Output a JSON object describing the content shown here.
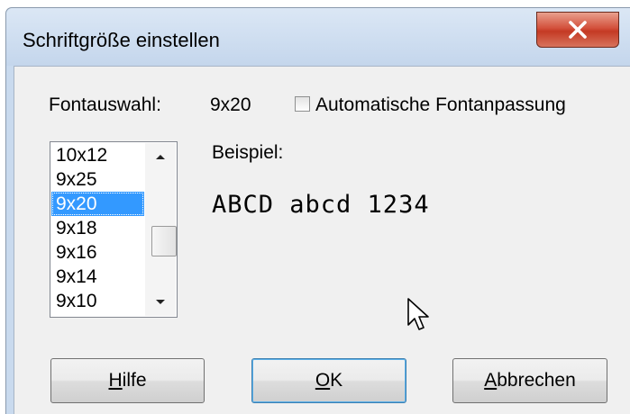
{
  "window": {
    "title": "Schriftgröße einstellen"
  },
  "title_bar": {
    "close_icon": "close-icon"
  },
  "font_selection": {
    "label": "Fontauswahl:",
    "current_value": "9x20",
    "auto_fit_checkbox": {
      "label": "Automatische Fontanpassung",
      "checked": false
    }
  },
  "font_list": {
    "items": [
      "10x12",
      "9x25",
      "9x20",
      "9x18",
      "9x16",
      "9x14",
      "9x10"
    ],
    "selected": "9x20"
  },
  "preview": {
    "label": "Beispiel:",
    "sample_text": "ABCD abcd 1234"
  },
  "buttons": {
    "help": {
      "mnemonic": "H",
      "rest": "ilfe"
    },
    "ok": {
      "mnemonic": "O",
      "rest": "K"
    },
    "cancel": {
      "mnemonic": "A",
      "rest": "bbrechen"
    }
  },
  "colors": {
    "selection": "#3399ff",
    "close_button": "#c43a24",
    "dialog_background": "#f0f0f0"
  }
}
